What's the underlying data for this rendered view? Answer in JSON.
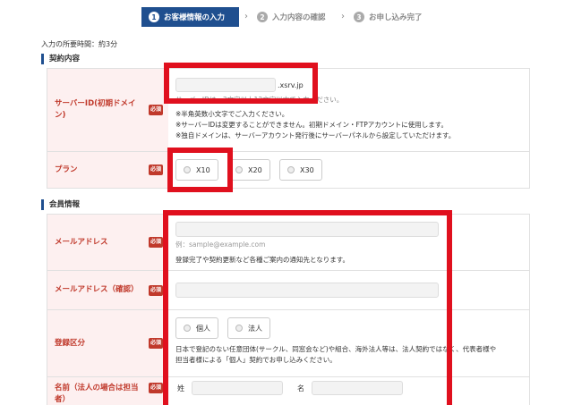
{
  "steps": [
    {
      "num": "1",
      "label": "お客様情報の入力"
    },
    {
      "num": "2",
      "label": "入力内容の確認"
    },
    {
      "num": "3",
      "label": "お申し込み完了"
    }
  ],
  "chevron": "›",
  "duration": "入力の所要時間：約3分",
  "contract": {
    "title": "契約内容",
    "server_label": "サーバーID(初期ドメイン)",
    "required": "必須",
    "domain_suffix": ".xsrv.jp",
    "server_hint": "サーバーIDは、3文字以上12文字以内で入力ください。",
    "notes": [
      "※半角英数小文字でご入力ください。",
      "※サーバーIDは変更することができません。初期ドメイン・FTPアカウントに使用します。",
      "※独自ドメインは、サーバーアカウント発行後にサーバーパネルから設定していただけます。"
    ],
    "plan_label": "プラン",
    "plans": [
      "X10",
      "X20",
      "X30"
    ]
  },
  "member": {
    "title": "会員情報",
    "email_label": "メールアドレス",
    "email_placeholder": "例：sample@example.com",
    "email_note": "登録完了や契約更新など各種ご案内の通知先となります。",
    "email_confirm_label": "メールアドレス（確認）",
    "type_label": "登録区分",
    "types": [
      "個人",
      "法人"
    ],
    "type_note": "日本で登記のない任意団体(サークル、同窓会など)や組合、海外法人等は、法人契約ではなく、代表者様や担当者様による「個人」契約でお申し込みください。",
    "name_label": "名前（法人の場合は担当者）",
    "last_name": "姓",
    "first_name": "名"
  },
  "colors": {
    "accent": "#1f4f8f",
    "required": "#c0392b",
    "highlight": "#e0101e"
  }
}
